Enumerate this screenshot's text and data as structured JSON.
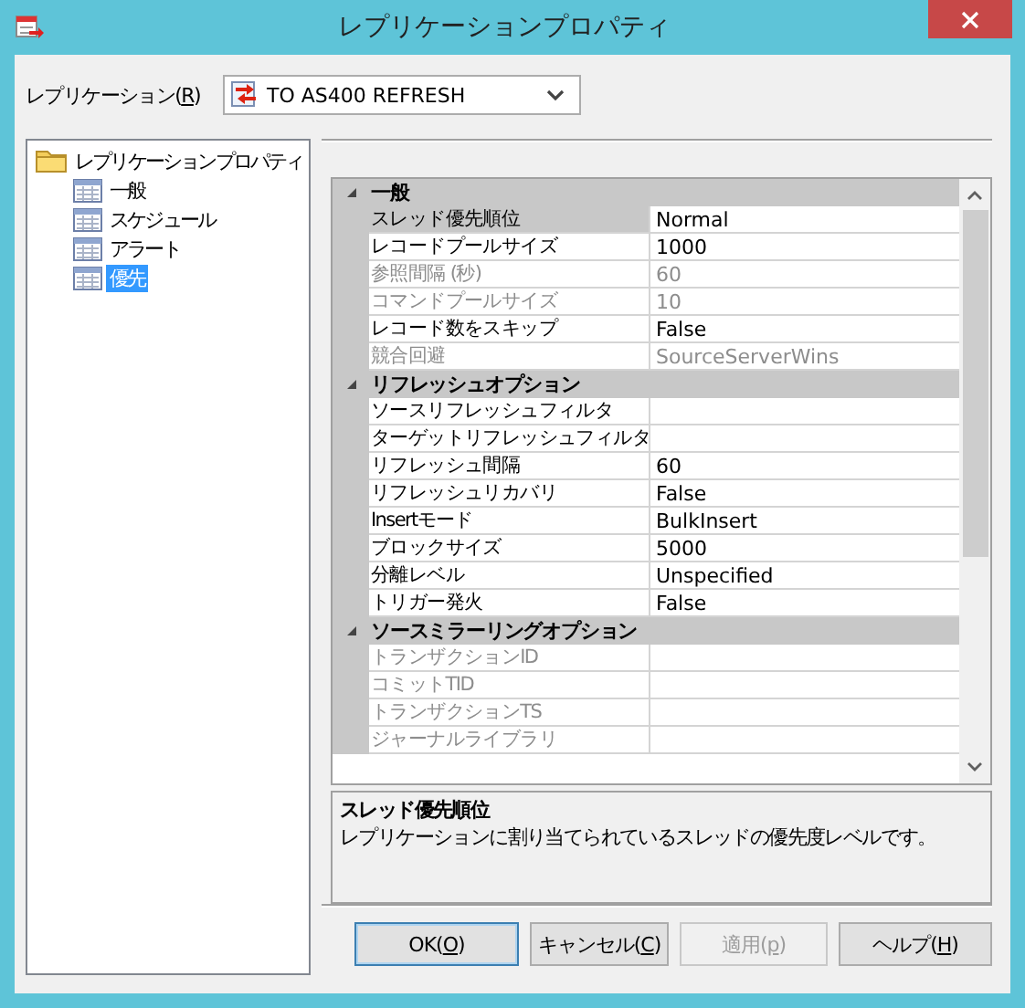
{
  "window": {
    "title": "レプリケーションプロパティ"
  },
  "replication": {
    "label_before": "レプリケーション(",
    "mnemonic": "R",
    "label_after": ")",
    "value": "TO AS400 REFRESH"
  },
  "tree": [
    {
      "label": "レプリケーションプロパティ",
      "kind": "folder",
      "expanded": true,
      "selected": false,
      "children": [
        {
          "label": "一般",
          "kind": "page",
          "selected": false
        },
        {
          "label": "スケジュール",
          "kind": "page",
          "selected": false
        },
        {
          "label": "アラート",
          "kind": "page",
          "selected": false
        },
        {
          "label": "優先",
          "kind": "page",
          "selected": true
        }
      ]
    }
  ],
  "grid": [
    {
      "kind": "category",
      "label": "一般",
      "expanded": true
    },
    {
      "kind": "property",
      "label": "スレッド優先順位",
      "value": "Normal",
      "disabled": false,
      "selected": true
    },
    {
      "kind": "property",
      "label": "レコードプールサイズ",
      "value": "1000",
      "disabled": false,
      "selected": false
    },
    {
      "kind": "property",
      "label": "参照間隔 (秒)",
      "value": "60",
      "disabled": true,
      "selected": false
    },
    {
      "kind": "property",
      "label": "コマンドプールサイズ",
      "value": "10",
      "disabled": true,
      "selected": false
    },
    {
      "kind": "property",
      "label": "レコード数をスキップ",
      "value": "False",
      "disabled": false,
      "selected": false
    },
    {
      "kind": "property",
      "label": "競合回避",
      "value": "SourceServerWins",
      "disabled": true,
      "selected": false
    },
    {
      "kind": "category",
      "label": "リフレッシュオプション",
      "expanded": true
    },
    {
      "kind": "property",
      "label": "ソースリフレッシュフィルタ",
      "disabled": false,
      "selected": false
    },
    {
      "kind": "property",
      "label": "ターゲットリフレッシュフィルタ",
      "disabled": false,
      "selected": false
    },
    {
      "kind": "property",
      "label": "リフレッシュ間隔",
      "value": "60",
      "disabled": false,
      "selected": false
    },
    {
      "kind": "property",
      "label": "リフレッシュリカバリ",
      "value": "False",
      "disabled": false,
      "selected": false
    },
    {
      "kind": "property",
      "label": "Insertモード",
      "value": "BulkInsert",
      "disabled": false,
      "selected": false
    },
    {
      "kind": "property",
      "label": "ブロックサイズ",
      "value": "5000",
      "disabled": false,
      "selected": false
    },
    {
      "kind": "property",
      "label": "分離レベル",
      "value": "Unspecified",
      "disabled": false,
      "selected": false
    },
    {
      "kind": "property",
      "label": "トリガー発火",
      "value": "False",
      "disabled": false,
      "selected": false
    },
    {
      "kind": "category",
      "label": "ソースミラーリングオプション",
      "expanded": true
    },
    {
      "kind": "property",
      "label": "トランザクションID",
      "disabled": true,
      "selected": false
    },
    {
      "kind": "property",
      "label": "コミットTID",
      "disabled": true,
      "selected": false
    },
    {
      "kind": "property",
      "label": "トランザクションTS",
      "disabled": true,
      "selected": false
    },
    {
      "kind": "property",
      "label": "ジャーナルライブラリ",
      "disabled": true,
      "selected": false
    }
  ],
  "description": {
    "title": "スレッド優先順位",
    "text": "レプリケーションに割り当てられているスレッドの優先度レベルです。"
  },
  "buttons": [
    {
      "label_before": "OK(",
      "mnemonic": "O",
      "label_after": ")",
      "default": true,
      "disabled": false
    },
    {
      "label_before": "キャンセル(",
      "mnemonic": "C",
      "label_after": ")",
      "default": false,
      "disabled": false
    },
    {
      "label_before": "適用(",
      "mnemonic": "p",
      "label_after": ")",
      "default": false,
      "disabled": true
    },
    {
      "label_before": "ヘルプ(",
      "mnemonic": "H",
      "label_after": ")",
      "default": false,
      "disabled": false
    }
  ]
}
